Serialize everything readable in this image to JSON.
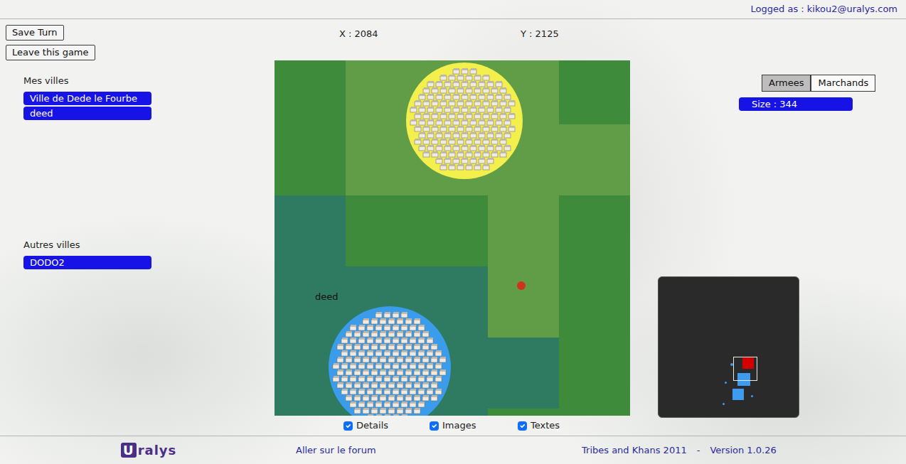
{
  "header": {
    "user": "Logged as : kikou2@uralys.com"
  },
  "actions": [
    "Save Turn",
    "Leave this game"
  ],
  "coords": {
    "x": "X : 2084",
    "y": "Y : 2125"
  },
  "my_cities": {
    "title": "Mes villes",
    "items": [
      "Ville de Dede le Fourbe",
      "deed"
    ]
  },
  "other_cities": {
    "title": "Autres villes",
    "items": [
      "DODO2"
    ]
  },
  "tabs": [
    {
      "label": "Armees",
      "selected": true
    },
    {
      "label": "Marchands",
      "selected": false
    }
  ],
  "size": "Size : 344",
  "map": {
    "tiles": [
      [
        "forest",
        "grass",
        "grass",
        "grass",
        "forest"
      ],
      [
        "forest",
        "grass",
        "grass",
        "grass",
        "grass"
      ],
      [
        "marsh",
        "forest",
        "forest",
        "grass",
        "forest"
      ],
      [
        "marsh",
        "marsh",
        "marsh",
        "grass",
        "forest"
      ],
      [
        "marsh",
        "marsh",
        "marsh",
        "marsh",
        "forest"
      ],
      [
        "marsh",
        "marsh",
        "marsh",
        "forest",
        "forest"
      ]
    ],
    "cities": [
      {
        "color": "#f3ef4c"
      },
      {
        "label": "deed",
        "color": "#3b9cec"
      }
    ],
    "army": {
      "color": "#d0321e"
    }
  },
  "toggles": [
    {
      "label": "Details",
      "checked": true
    },
    {
      "label": "Images",
      "checked": true
    },
    {
      "label": "Textes",
      "checked": true
    }
  ],
  "minimap": {
    "markers": [
      {
        "color": "#d40000"
      },
      {
        "color": "#3d9bf0"
      },
      {
        "color": "#3d9bf0"
      },
      {
        "color": "#3d9bf0"
      },
      {
        "color": "#3d9bf0"
      },
      {
        "color": "#3d9bf0"
      },
      {
        "color": "#3d9bf0"
      }
    ]
  },
  "footer": {
    "logo": "Uralys",
    "forum": "Aller sur le forum",
    "credit": "Tribes and Khans 2011",
    "separator": "-",
    "version": "Version 1.0.26"
  }
}
